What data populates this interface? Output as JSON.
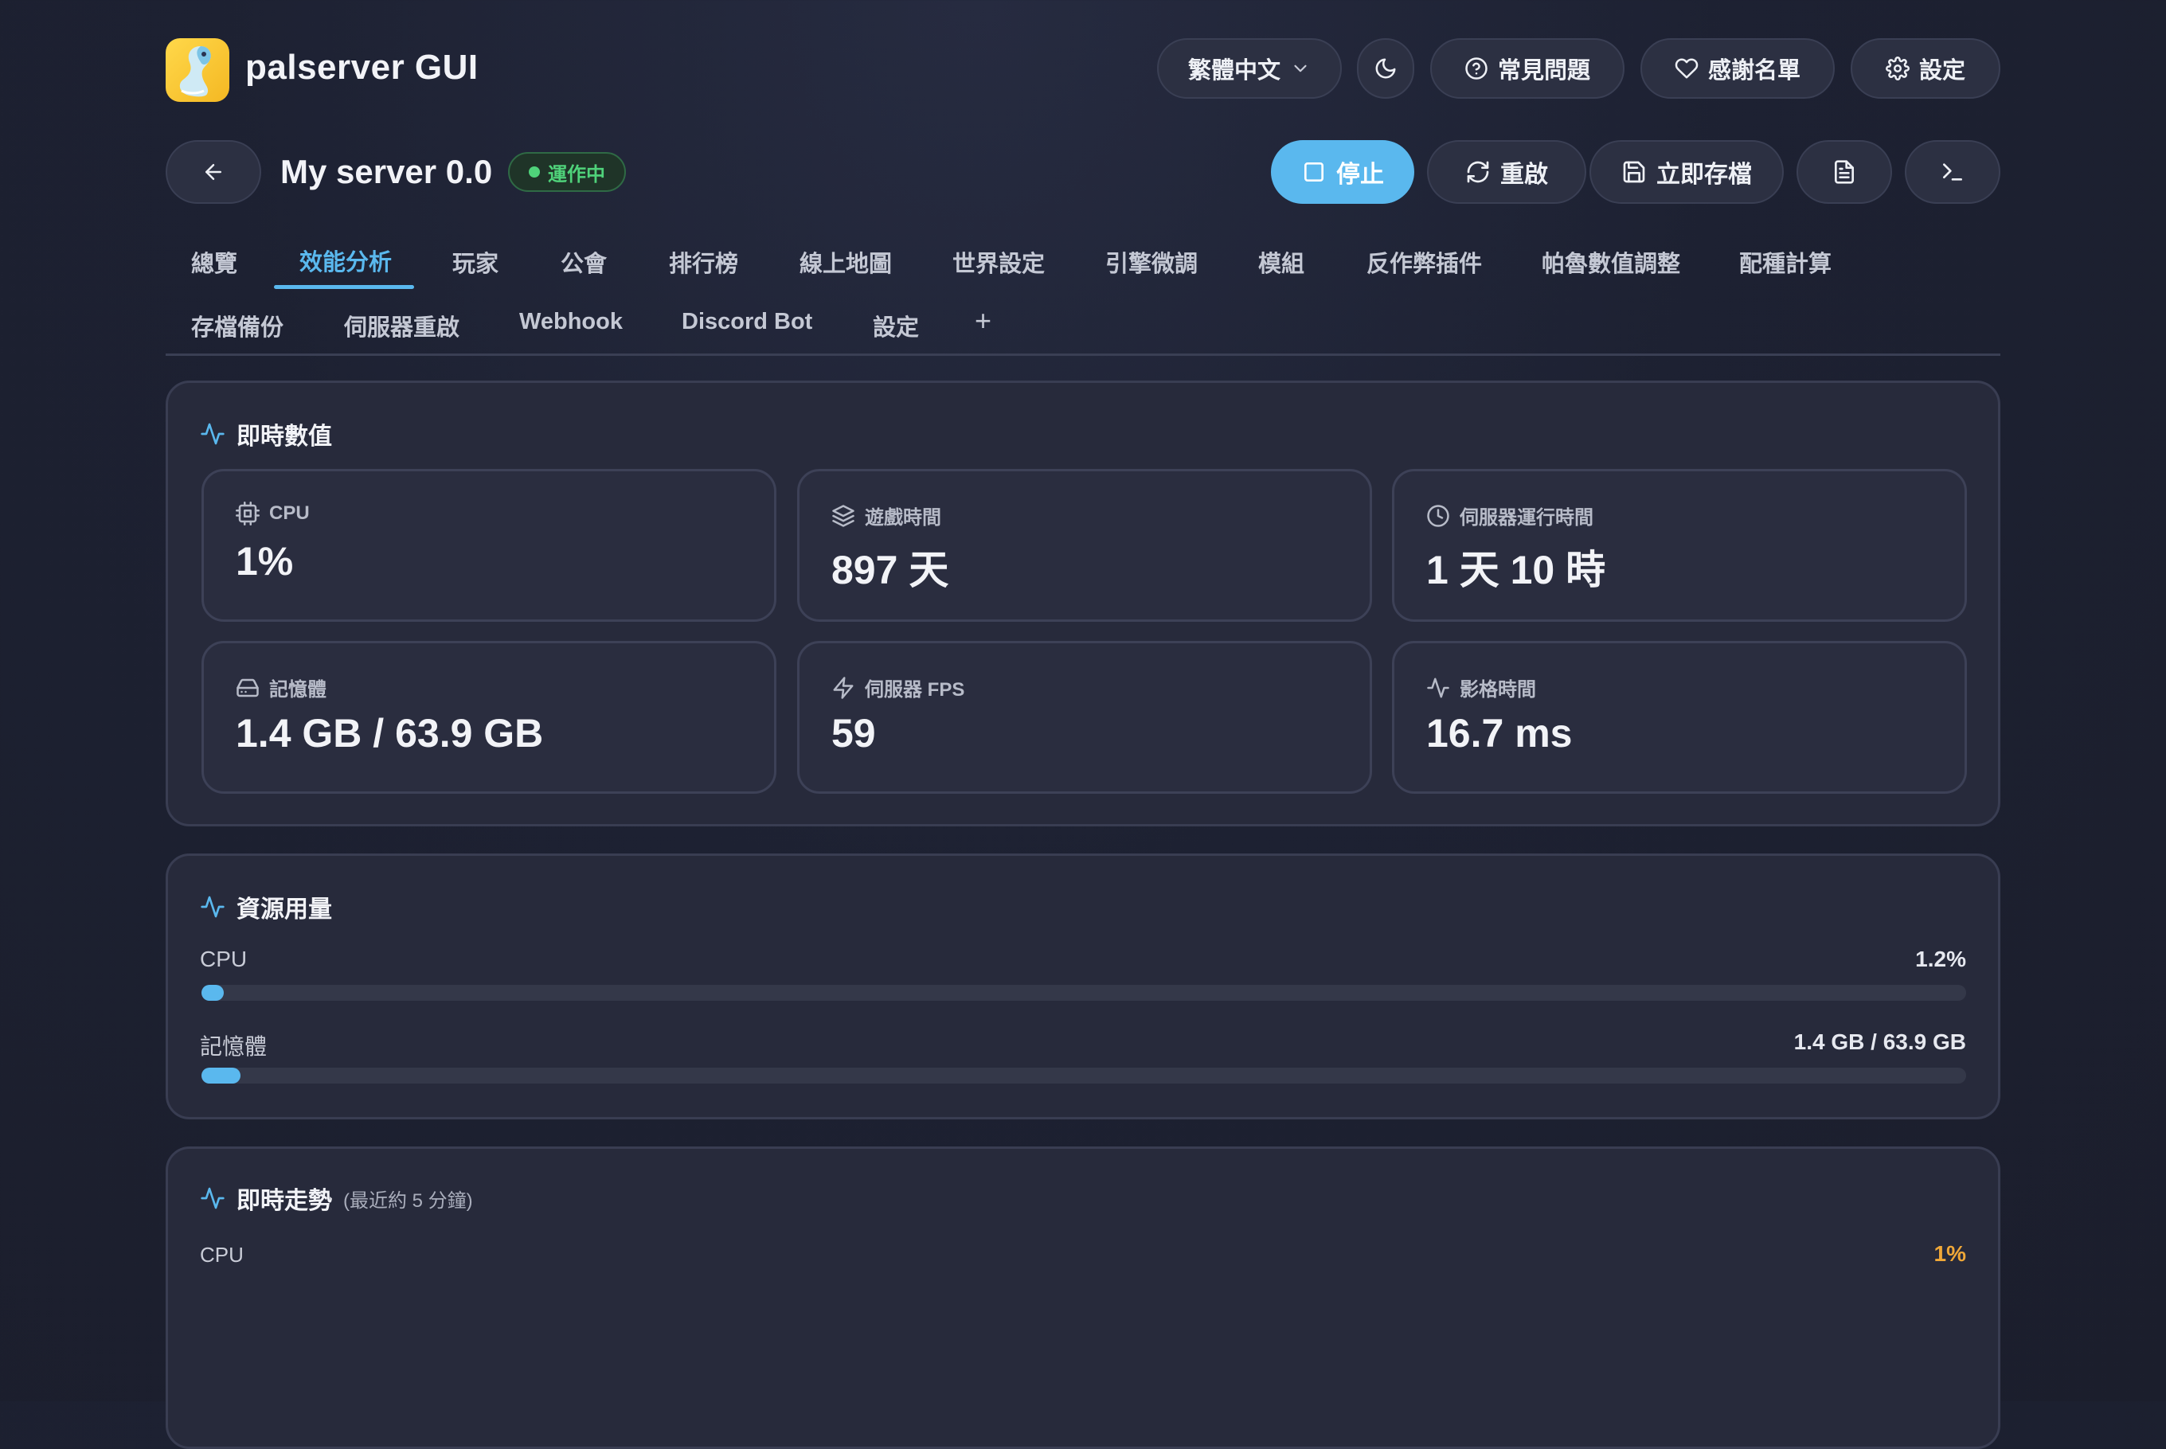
{
  "app": {
    "title": "palserver GUI"
  },
  "header": {
    "language": "繁體中文",
    "faq": "常見問題",
    "thanks": "感謝名單",
    "settings": "設定"
  },
  "server": {
    "name": "My server 0.0",
    "status": "運作中",
    "actions": {
      "stop": "停止",
      "restart": "重啟",
      "save": "立即存檔"
    }
  },
  "tabs": {
    "row1": [
      "總覽",
      "效能分析",
      "玩家",
      "公會",
      "排行榜",
      "線上地圖",
      "世界設定",
      "引擎微調",
      "模組",
      "反作弊插件",
      "帕魯數值調整",
      "配種計算"
    ],
    "row2": [
      "存檔備份",
      "伺服器重啟",
      "Webhook",
      "Discord Bot",
      "設定",
      "+"
    ],
    "active": "效能分析"
  },
  "realtime": {
    "title": "即時數值",
    "metrics": [
      {
        "label": "CPU",
        "value": "1%",
        "icon": "cpu-icon"
      },
      {
        "label": "遊戲時間",
        "value": "897 天",
        "icon": "layers-icon"
      },
      {
        "label": "伺服器運行時間",
        "value": "1 天 10 時",
        "icon": "clock-icon"
      },
      {
        "label": "記憶體",
        "value": "1.4 GB / 63.9 GB",
        "icon": "hard-drive-icon"
      },
      {
        "label": "伺服器 FPS",
        "value": "59",
        "icon": "zap-icon"
      },
      {
        "label": "影格時間",
        "value": "16.7 ms",
        "icon": "activity-icon"
      }
    ]
  },
  "resources": {
    "title": "資源用量",
    "cpu": {
      "label": "CPU",
      "value": "1.2%",
      "fraction": 0.012
    },
    "memory": {
      "label": "記憶體",
      "value": "1.4 GB / 63.9 GB",
      "fraction": 0.022
    }
  },
  "trend": {
    "title": "即時走勢",
    "subtitle": "(最近約 5 分鐘)",
    "series_label": "CPU",
    "current": "1%"
  },
  "colors": {
    "accent": "#5ab8ee",
    "running": "#4fd27a",
    "trend_value": "#f0a838",
    "background": "#1d2132",
    "card": "#272a3b"
  }
}
